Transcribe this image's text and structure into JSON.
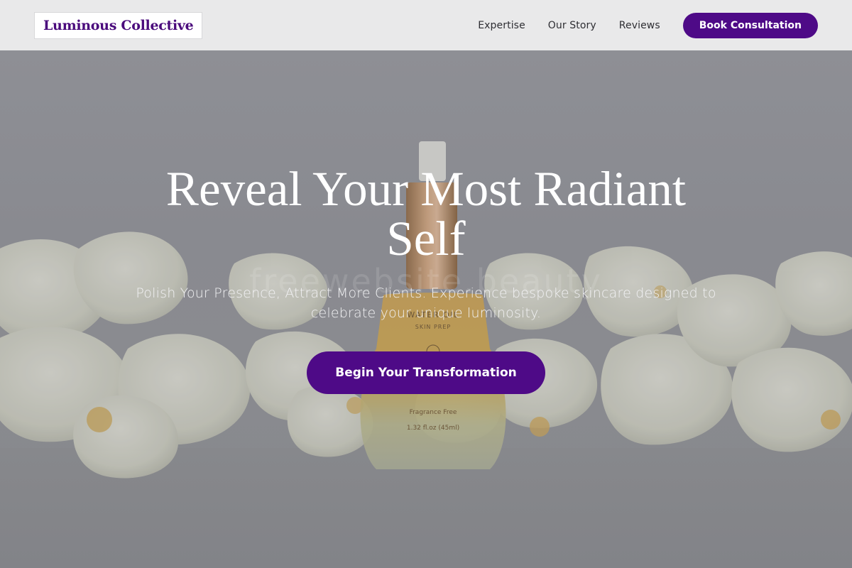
{
  "header": {
    "logo": "Luminous Collective",
    "nav": [
      {
        "label": "Expertise"
      },
      {
        "label": "Our Story"
      },
      {
        "label": "Reviews"
      }
    ],
    "cta_label": "Book Consultation"
  },
  "hero": {
    "title": "Reveal Your Most Radiant Self",
    "subtitle": "Polish Your Presence, Attract More Clients. Experience bespoke skincare designed to celebrate your unique luminosity.",
    "cta_label": "Begin Your Transformation",
    "watermark": "freewebsite.beauty",
    "bottle_label": {
      "line1": "WATER OIL",
      "line2": "SKIN PREP",
      "line3": "Fragrance Free",
      "line4": "1.32 fl.oz (45ml)"
    }
  },
  "colors": {
    "accent": "#4e0a87",
    "logo_text": "#4a0a7c",
    "header_bg": "#e9e9ea"
  }
}
